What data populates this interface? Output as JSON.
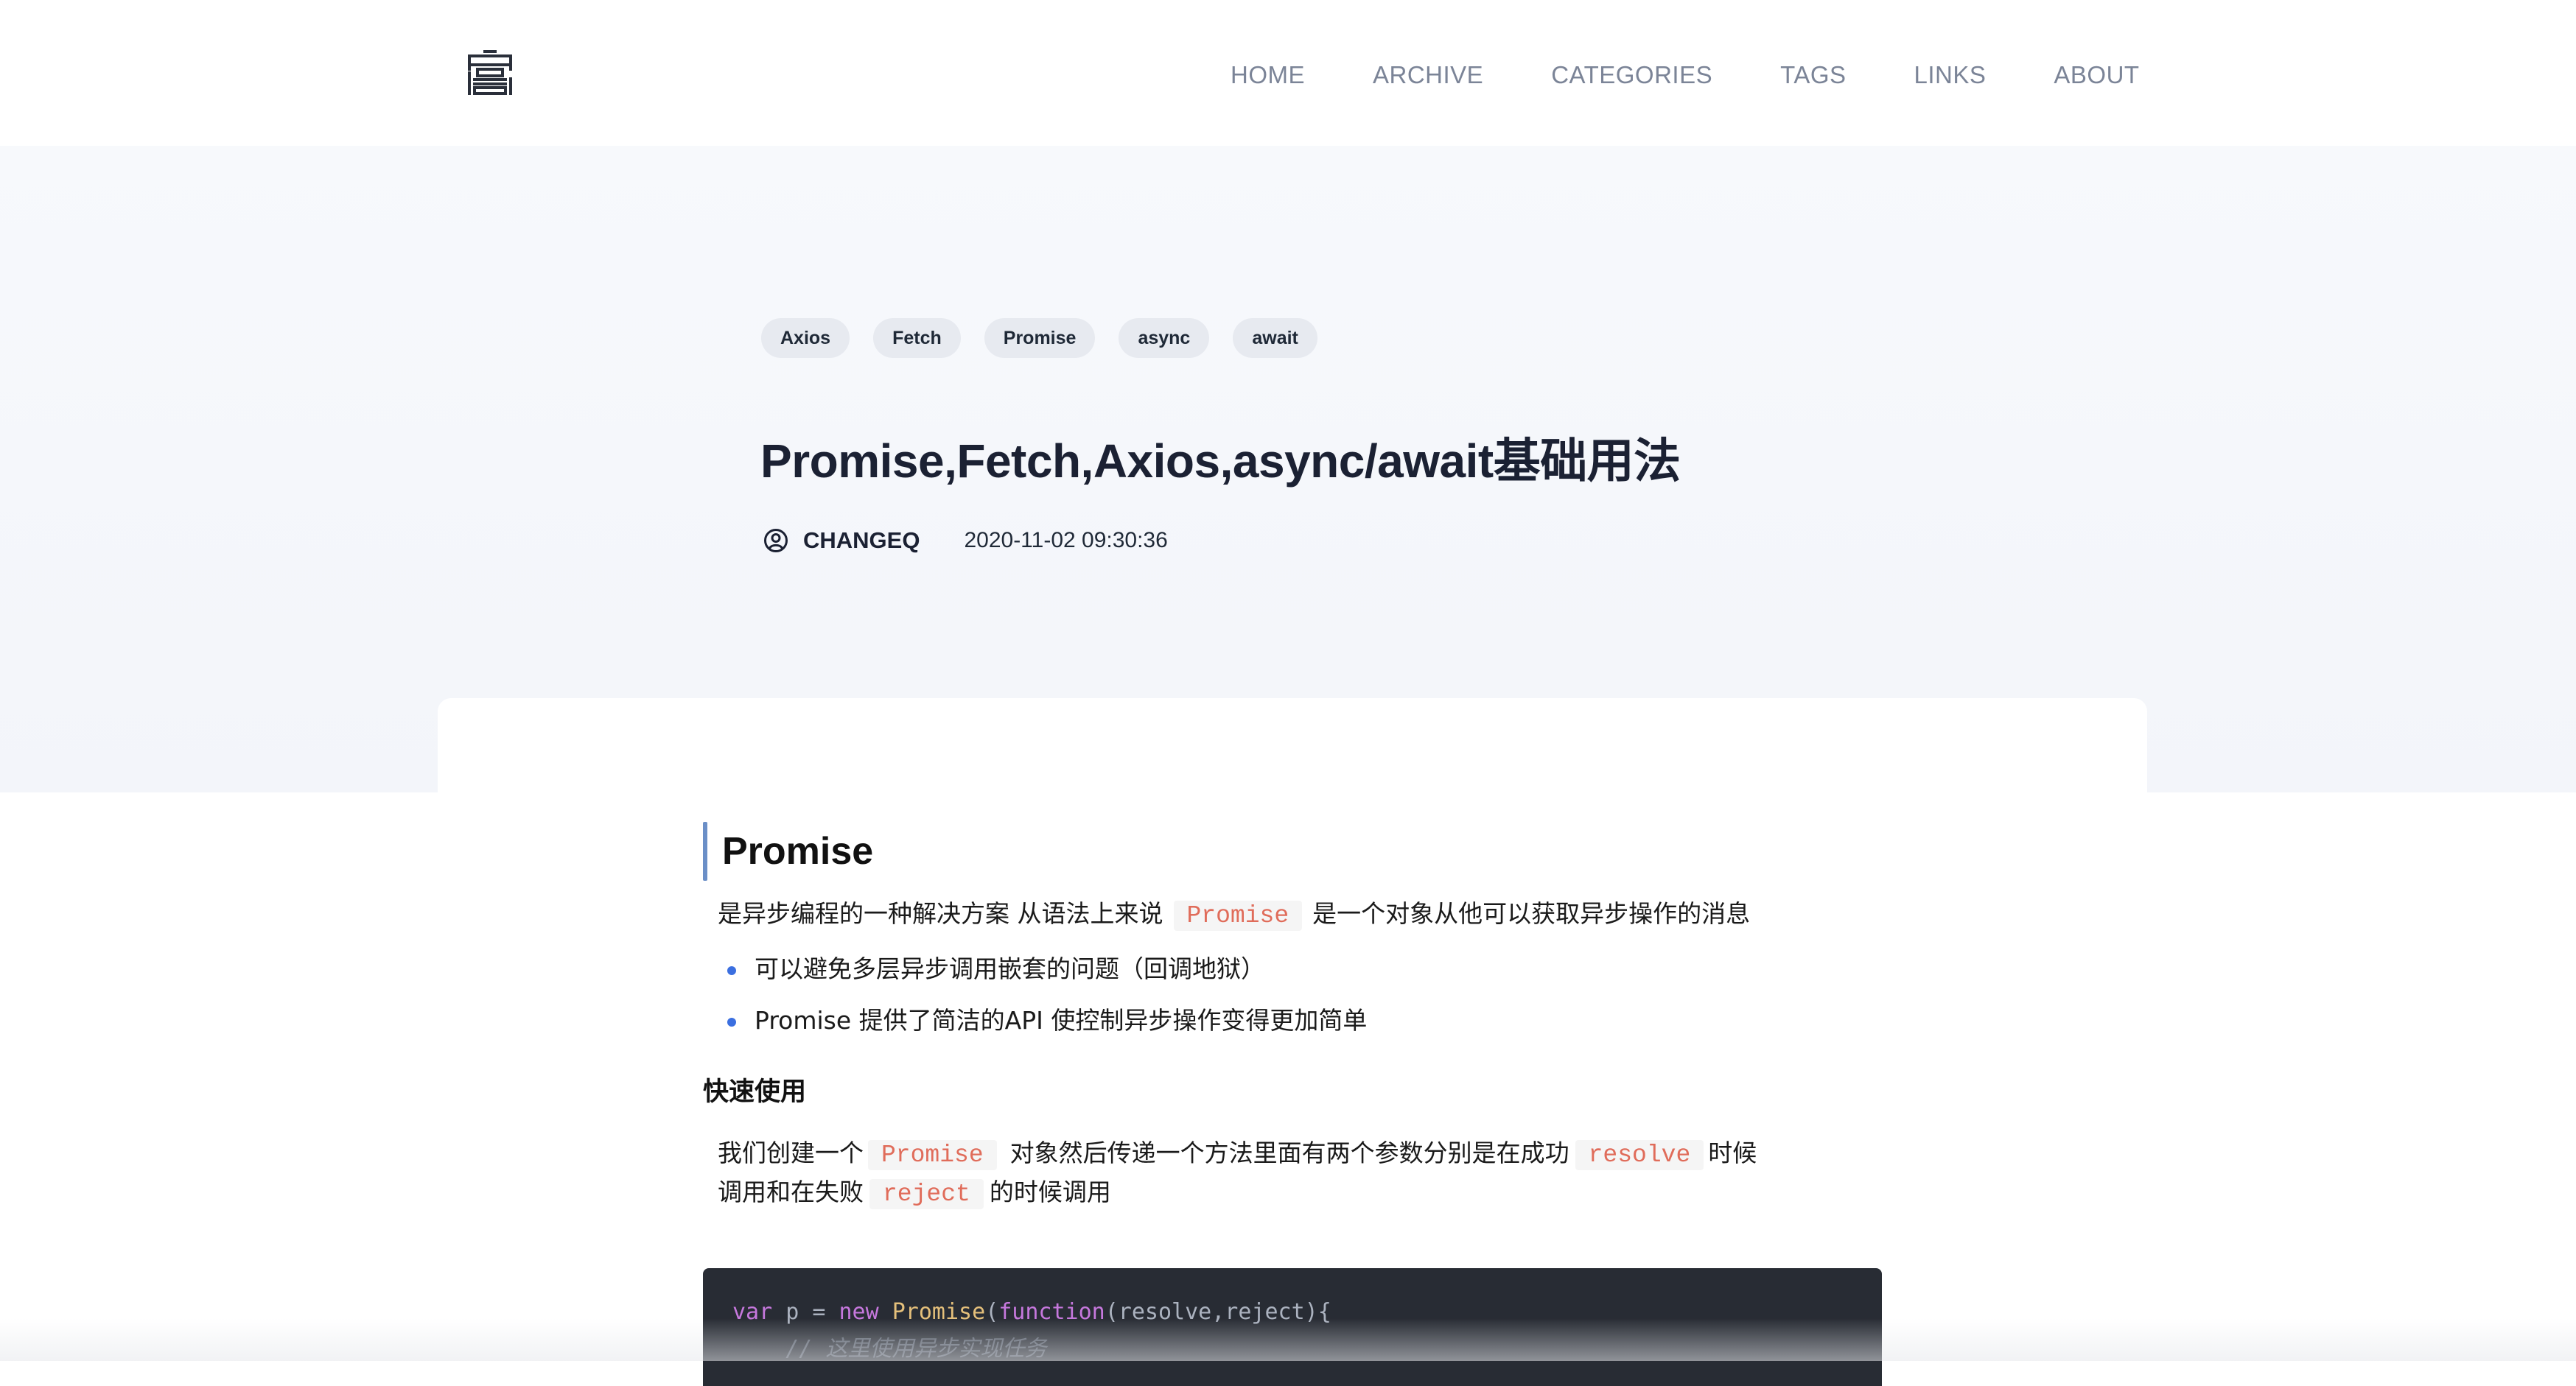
{
  "nav": {
    "items": [
      "HOME",
      "ARCHIVE",
      "CATEGORIES",
      "TAGS",
      "LINKS",
      "ABOUT"
    ]
  },
  "logo": {
    "icon": "site-logo-icon"
  },
  "post": {
    "tags": [
      "Axios",
      "Fetch",
      "Promise",
      "async",
      "await"
    ],
    "title": "Promise,Fetch,Axios,async/await基础用法",
    "author": "CHANGEQ",
    "date": "2020-11-02 09:30:36",
    "author_icon": "user-circle-icon"
  },
  "content": {
    "h2": "Promise",
    "p1_before": "是异步编程的一种解决方案 从语法上来说",
    "p1_code": "Promise",
    "p1_after": "是一个对象从他可以获取异步操作的消息",
    "list": [
      "可以避免多层异步调用嵌套的问题（回调地狱）",
      "Promise 提供了简洁的API 使控制异步操作变得更加简单"
    ],
    "h3": "快速使用",
    "p2_a": "我们创建一个",
    "p2_code1": "Promise",
    "p2_b": "对象然后传递一个方法里面有两个参数分别是在成功",
    "p2_code2": "resolve",
    "p2_c": "时候",
    "p2_d": "调用和在失败",
    "p2_code3": "reject",
    "p2_e": "的时候调用"
  },
  "code": {
    "line1": {
      "kw1": "var",
      "plain1": " p = ",
      "kw2": "new",
      "plain2": " ",
      "cls": "Promise",
      "plain3": "(",
      "kw3": "function",
      "plain4": "(resolve,reject){"
    },
    "line2": "    // 这里使用异步实现任务"
  },
  "colors": {
    "accent": "#6b8fc7",
    "bullet": "#3b6fe0",
    "inline_code": "#e06c5a",
    "code_bg": "#282c34"
  }
}
